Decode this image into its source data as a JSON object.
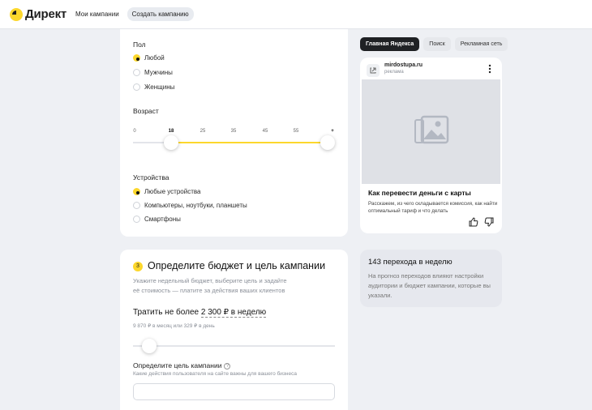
{
  "brand": {
    "name": "Директ",
    "accent": "#fcd72c"
  },
  "nav": {
    "items": [
      {
        "label": "Мои кампании"
      },
      {
        "label": "Создать кампанию"
      }
    ]
  },
  "gender": {
    "title": "Пол",
    "options": [
      "Любой",
      "Мужчины",
      "Женщины"
    ],
    "selected": "Любой"
  },
  "age": {
    "title": "Возраст",
    "ticks": [
      "0",
      "18",
      "25",
      "35",
      "45",
      "55",
      "+"
    ],
    "range_from": "18",
    "range_to": "+"
  },
  "devices": {
    "title": "Устройства",
    "options": [
      "Любые устройства",
      "Компьютеры, ноутбуки, планшеты",
      "Смартфоны"
    ],
    "selected": "Любые устройства"
  },
  "budget_section": {
    "step": "3",
    "title": "Определите бюджет и цель кампании",
    "description_1": "Укажите недельный бюджет, выберите цель и задайте",
    "description_2": "её стоимость — платите за действия ваших клиентов",
    "spend_prefix": "Тратить не более ",
    "spend_amount": "2 300 ₽ в неделю",
    "spend_sub": "9 870 ₽ в месяц или 329 ₽ в день",
    "slider_level_pct": 8,
    "goal_label": "Определите цель кампании",
    "goal_help_icon": "question-icon",
    "goal_sub": "Какие действия пользователя на сайте важны для вашего бизнеса",
    "goal_value": ""
  },
  "preview": {
    "tabs": [
      "Главная Яндекса",
      "Поиск",
      "Рекламная сеть"
    ],
    "active_tab": "Главная Яндекса",
    "ad": {
      "domain": "mirdostupa.ru",
      "tag": "реклама",
      "title": "Как перевести деньги с карты",
      "text": "Расскажем, из чего складывается комиссия, как найти оптимальный тариф и что делать"
    }
  },
  "forecast": {
    "title": "143 перехода в неделю",
    "text": "На прогноз переходов влияют настройки аудитории и бюджет кампании, которые вы указали."
  }
}
